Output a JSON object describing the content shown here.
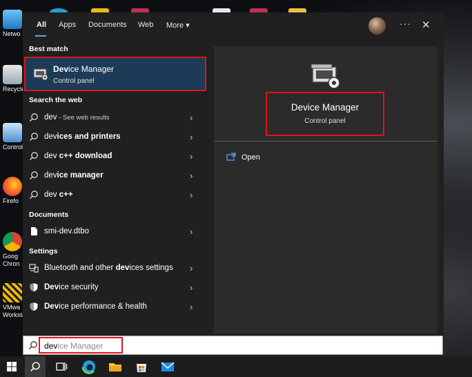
{
  "desktop": {
    "icons": [
      {
        "name": "network",
        "label": "Netwo"
      },
      {
        "name": "recycle-bin",
        "label": "Recycle"
      },
      {
        "name": "control-panel",
        "label": "Control P"
      },
      {
        "name": "firefox",
        "label": "Firefo"
      },
      {
        "name": "chrome",
        "label": "Goog\nChron"
      },
      {
        "name": "vmware",
        "label": "VMwa\nWorksta"
      }
    ]
  },
  "nav": {
    "tabs": [
      {
        "label": "All",
        "active": true
      },
      {
        "label": "Apps"
      },
      {
        "label": "Documents"
      },
      {
        "label": "Web"
      },
      {
        "label": "More"
      }
    ],
    "more_chevron": "▾",
    "dots": "···",
    "close": "✕"
  },
  "sections": {
    "best_match": "Best match",
    "search_web": "Search the web",
    "documents": "Documents",
    "settings": "Settings"
  },
  "best_match": {
    "title_bold": "Dev",
    "title_rest": "ice Manager",
    "subtitle": "Control panel"
  },
  "web_results": [
    {
      "bold": "",
      "text": "dev",
      "sub": " - See web results"
    },
    {
      "bold": "",
      "text": "devices and printers",
      "boldall": true
    },
    {
      "bold": "",
      "text": "dev c++ download",
      "boldall": true
    },
    {
      "bold": "",
      "text": "device manager",
      "boldall": true
    },
    {
      "bold": "",
      "text": "dev c++",
      "boldall": true
    }
  ],
  "documents": [
    {
      "text": "smi-dev.dtbo"
    }
  ],
  "settings": [
    {
      "pre": "Bluetooth and other ",
      "bold": "dev",
      "post": "ices settings"
    },
    {
      "pre": "",
      "bold": "Dev",
      "post": "ice security"
    },
    {
      "pre": "",
      "bold": "Dev",
      "post": "ice performance & health"
    }
  ],
  "detail": {
    "title": "Device Manager",
    "subtitle": "Control panel",
    "action_open": "Open"
  },
  "search": {
    "typed": "dev",
    "hint": "ice Manager"
  },
  "colors": {
    "accent": "#5ba3ff",
    "highlight_border": "#e0141a",
    "selected_bg": "#1d3a56"
  }
}
